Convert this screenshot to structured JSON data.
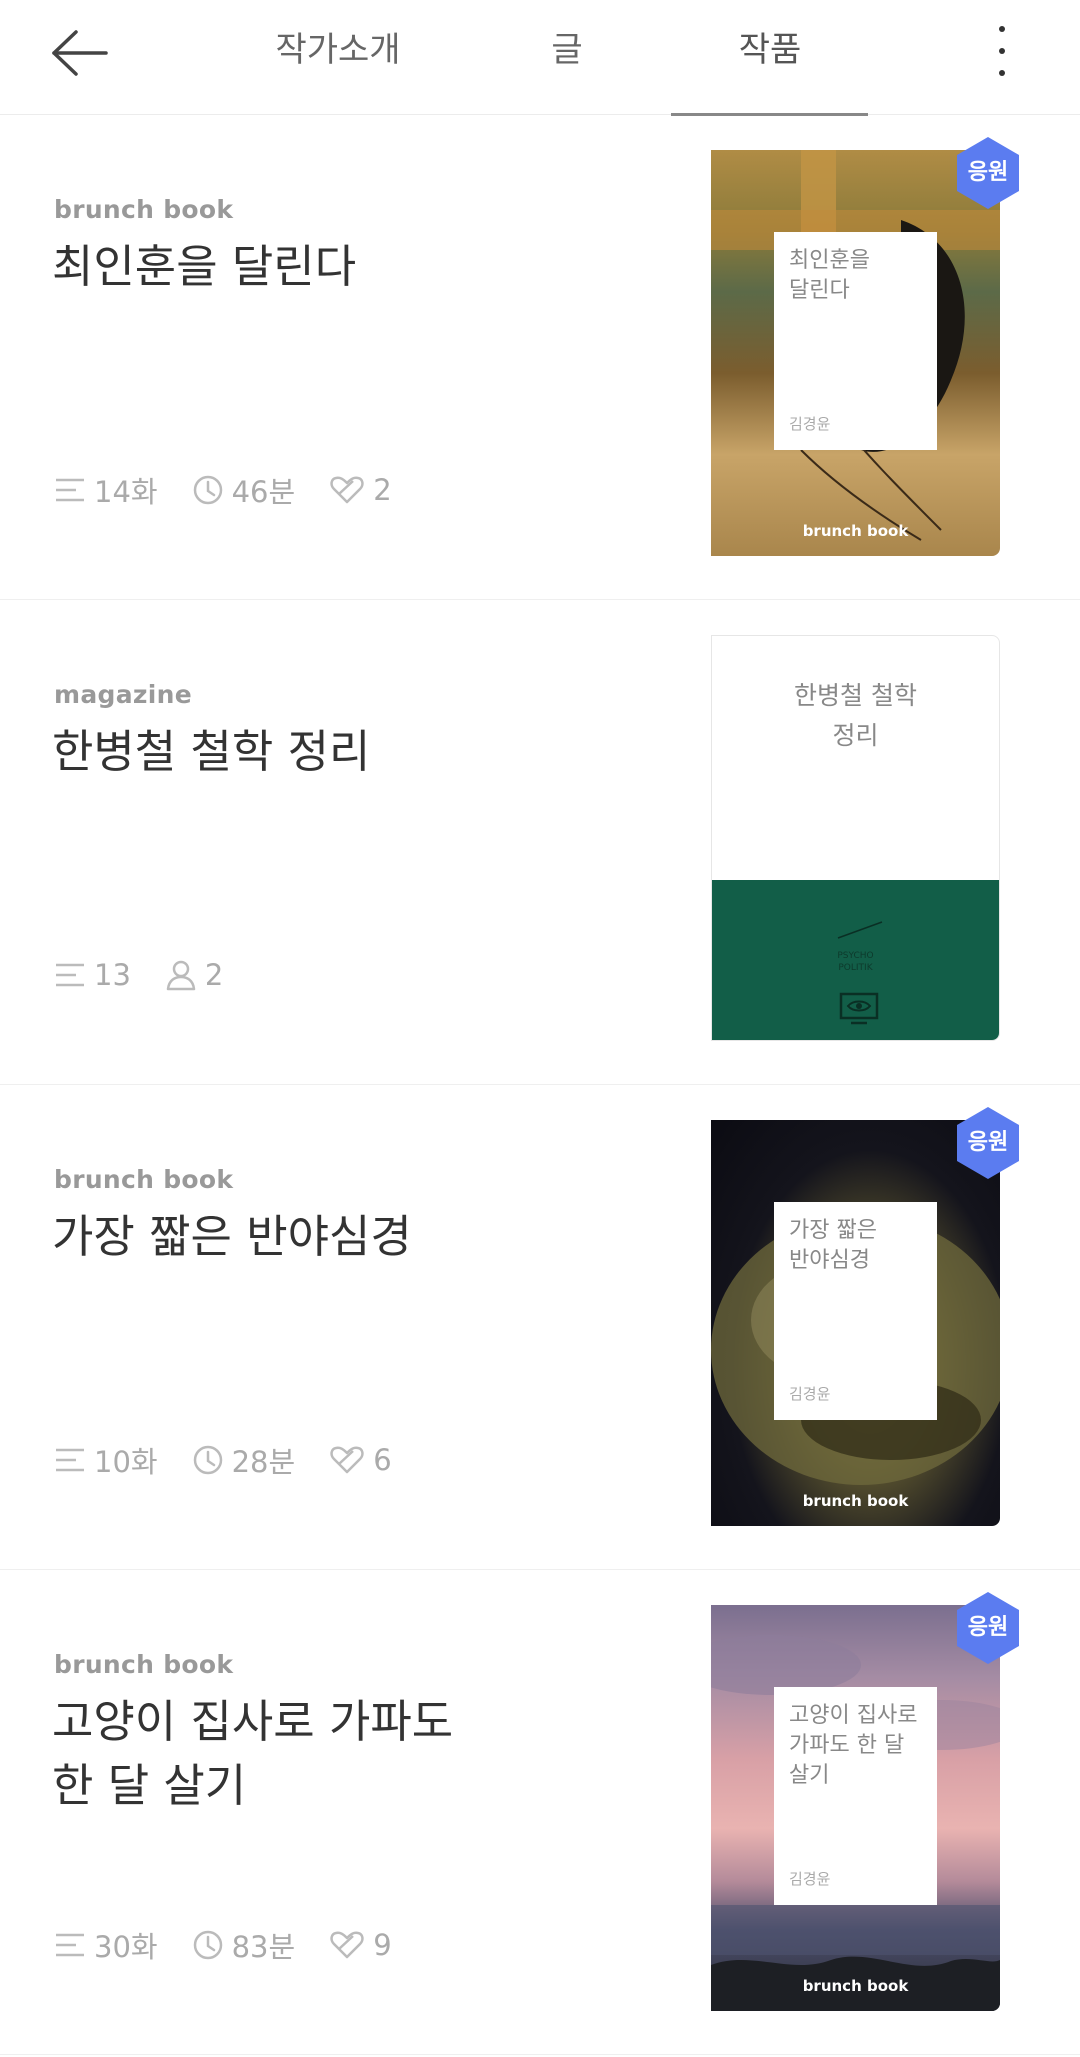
{
  "header": {
    "tabs": [
      "작가소개",
      "글",
      "작품"
    ],
    "active_tab": "작품"
  },
  "items": [
    {
      "type_label": "brunch book",
      "title": "최인훈을 달린다",
      "meta": {
        "episodes": "14화",
        "time": "46분",
        "likes": "2"
      },
      "cover": {
        "title": "최인훈을\n달린다",
        "author": "김경윤",
        "footer": "brunch book"
      },
      "badge": "응원"
    },
    {
      "type_label": "magazine",
      "title": "한병철 철학 정리",
      "meta": {
        "episodes": "13",
        "subscribers": "2"
      },
      "cover": {
        "title": "한병철 철학\n정리",
        "brand_line1": "PSYCHO",
        "brand_line2": "POLITIK"
      }
    },
    {
      "type_label": "brunch book",
      "title": "가장 짧은 반야심경",
      "meta": {
        "episodes": "10화",
        "time": "28분",
        "likes": "6"
      },
      "cover": {
        "title": "가장 짧은\n반야심경",
        "author": "김경윤",
        "footer": "brunch book"
      },
      "badge": "응원"
    },
    {
      "type_label": "brunch book",
      "title": "고양이 집사로 가파도\n한 달 살기",
      "meta": {
        "episodes": "30화",
        "time": "83분",
        "likes": "9"
      },
      "cover": {
        "title": "고양이 집사로\n가파도 한 달\n살기",
        "author": "김경윤",
        "footer": "brunch book"
      },
      "badge": "응원"
    }
  ],
  "colors": {
    "badge": "#5b7cf0",
    "magazine_green": "#125e48",
    "text_dark": "#333333",
    "text_muted": "#999999"
  },
  "icons": {
    "back": "arrow-left-icon",
    "more": "more-vertical-icon",
    "episodes": "list-lines-icon",
    "time": "clock-icon",
    "likes": "heart-outline-icon",
    "subscribers": "person-icon"
  }
}
